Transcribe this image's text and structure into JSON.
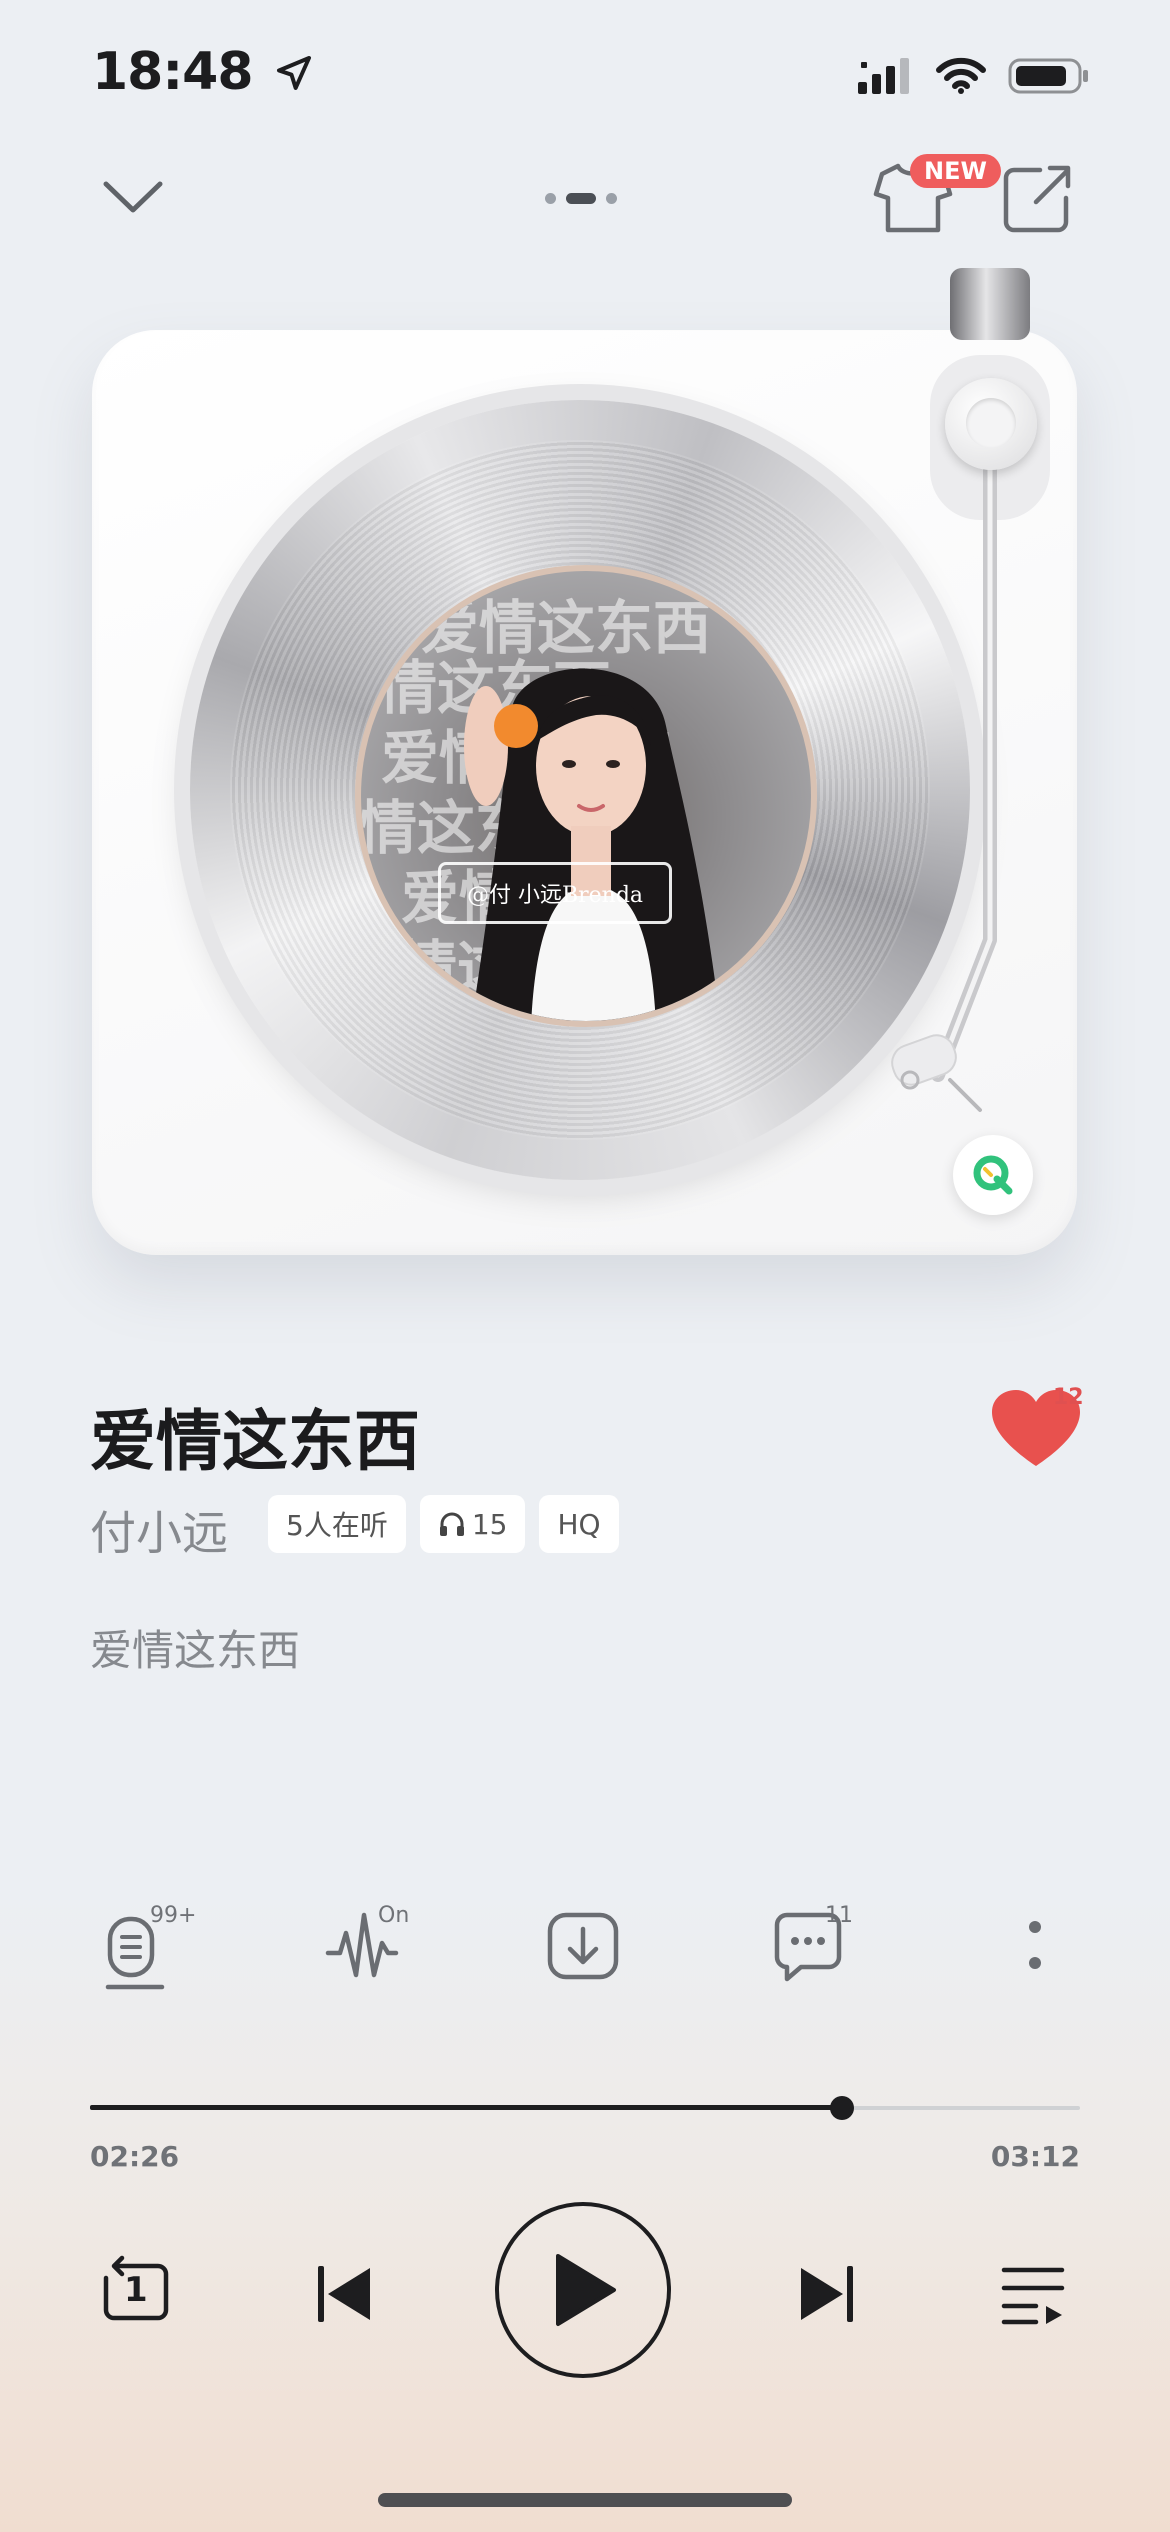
{
  "status": {
    "time": "18:48",
    "icons": [
      "location-arrow-icon",
      "cellular-signal-icon",
      "wifi-icon",
      "battery-icon"
    ]
  },
  "nav": {
    "collapse_icon": "chevron-down-icon",
    "page_count": 3,
    "active_page": 2,
    "new_badge": "NEW",
    "skin_icon": "tshirt-icon",
    "share_icon": "share-icon"
  },
  "album": {
    "cover_overlay_text": "爱情这东西",
    "watermark": "@付 小远Brenda",
    "qq_logo": "Q"
  },
  "song": {
    "title": "爱情这东西",
    "artist": "付小远",
    "listeners": "5人在听",
    "plays": "15",
    "quality": "HQ",
    "lyric_line": "爱情这东西",
    "like_count": "12"
  },
  "actions": {
    "lyrics_badge": "99+",
    "effect_badge": "On",
    "comment_count": "11"
  },
  "progress": {
    "current": "02:26",
    "total": "03:12",
    "fraction": 0.76
  },
  "player": {
    "repeat_mode_number": "1"
  },
  "colors": {
    "accent_red": "#ef5d5d",
    "heart": "#e8514e",
    "qq_green": "#31c27c"
  }
}
